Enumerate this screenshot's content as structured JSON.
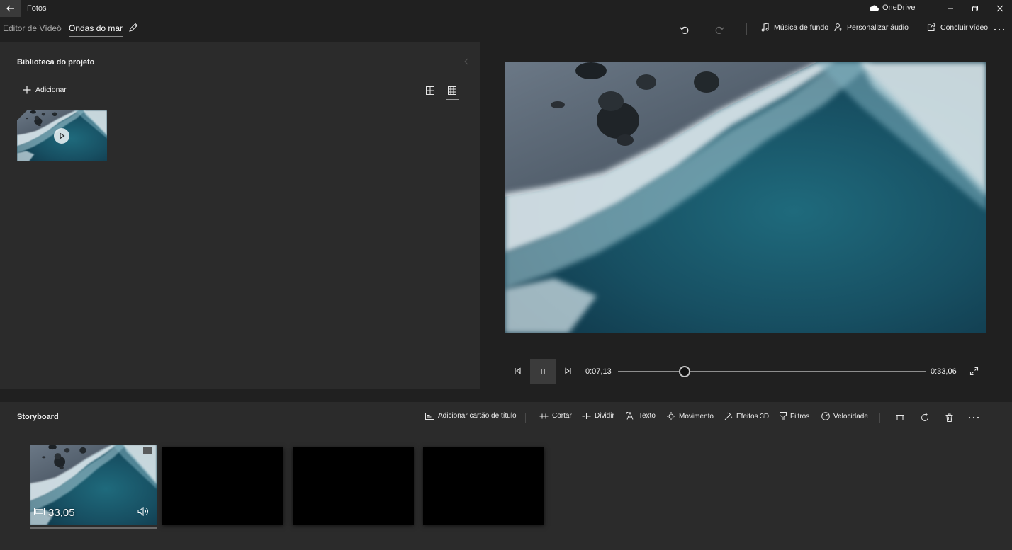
{
  "titlebar": {
    "app_name": "Fotos",
    "onedrive_label": "OneDrive",
    "icons": [
      "back-arrow-icon",
      "cloud-icon",
      "minimize-icon",
      "restore-icon",
      "close-icon"
    ]
  },
  "breadcrumb": {
    "root": "Editor de Vídeo",
    "current": "Ondas do mar"
  },
  "toolbar": {
    "background_music": "Música de fundo",
    "custom_audio": "Personalizar áudio",
    "finish_video": "Concluir vídeo",
    "icons": [
      "undo-icon",
      "redo-icon",
      "music-note-icon",
      "person-audio-icon",
      "share-icon",
      "more-icon"
    ]
  },
  "library": {
    "title": "Biblioteca do projeto",
    "add_label": "Adicionar",
    "icons": [
      "plus-icon",
      "grid-large-icon",
      "grid-small-icon",
      "play-icon"
    ]
  },
  "player": {
    "current_time": "0:07,13",
    "total_time": "0:33,06",
    "progress": 0.216,
    "icons": [
      "step-back-icon",
      "pause-icon",
      "step-forward-icon",
      "fullscreen-icon"
    ]
  },
  "storyboard": {
    "title": "Storyboard",
    "tools": {
      "title_card": "Adicionar cartão de título",
      "trim": "Cortar",
      "split": "Dividir",
      "text": "Texto",
      "motion": "Movimento",
      "effects_3d": "Efeitos 3D",
      "filters": "Filtros",
      "speed": "Velocidade"
    },
    "clip": {
      "duration": "33,05"
    },
    "empty_slots": 3
  },
  "colors": {
    "background": "#202020",
    "panel": "#2b2b2b",
    "accent_button": "#3b3b3b",
    "text": "#ffffff"
  }
}
